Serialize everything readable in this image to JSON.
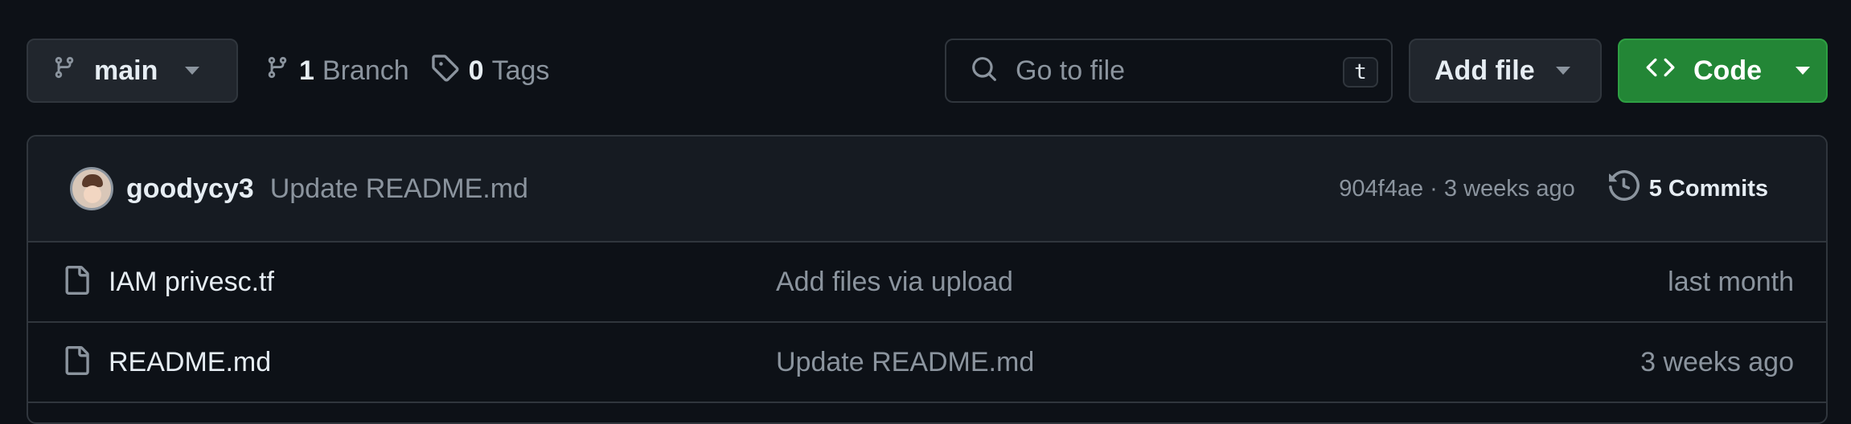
{
  "toolbar": {
    "branch_name": "main",
    "branches_count": "1",
    "branches_label": "Branch",
    "tags_count": "0",
    "tags_label": "Tags",
    "search_placeholder": "Go to file",
    "search_shortcut": "t",
    "add_file_label": "Add file",
    "code_label": "Code"
  },
  "latest_commit": {
    "author": "goodycy3",
    "message": "Update README.md",
    "hash": "904f4ae",
    "time": "3 weeks ago",
    "meta_text": "904f4ae · 3 weeks ago",
    "commits_label": "5 Commits"
  },
  "files": [
    {
      "name": "IAM privesc.tf",
      "message": "Add files via upload",
      "time": "last month"
    },
    {
      "name": "README.md",
      "message": "Update README.md",
      "time": "3 weeks ago"
    }
  ],
  "icons": {
    "branch": "git-branch-icon",
    "tag": "tag-icon",
    "search": "search-icon",
    "code": "code-icon",
    "history": "history-icon",
    "file": "file-icon"
  },
  "colors": {
    "background": "#0d1117",
    "border": "#30363d",
    "button_bg": "#21262d",
    "code_button": "#238636",
    "muted_text": "#8b949e",
    "text": "#e6edf3"
  }
}
